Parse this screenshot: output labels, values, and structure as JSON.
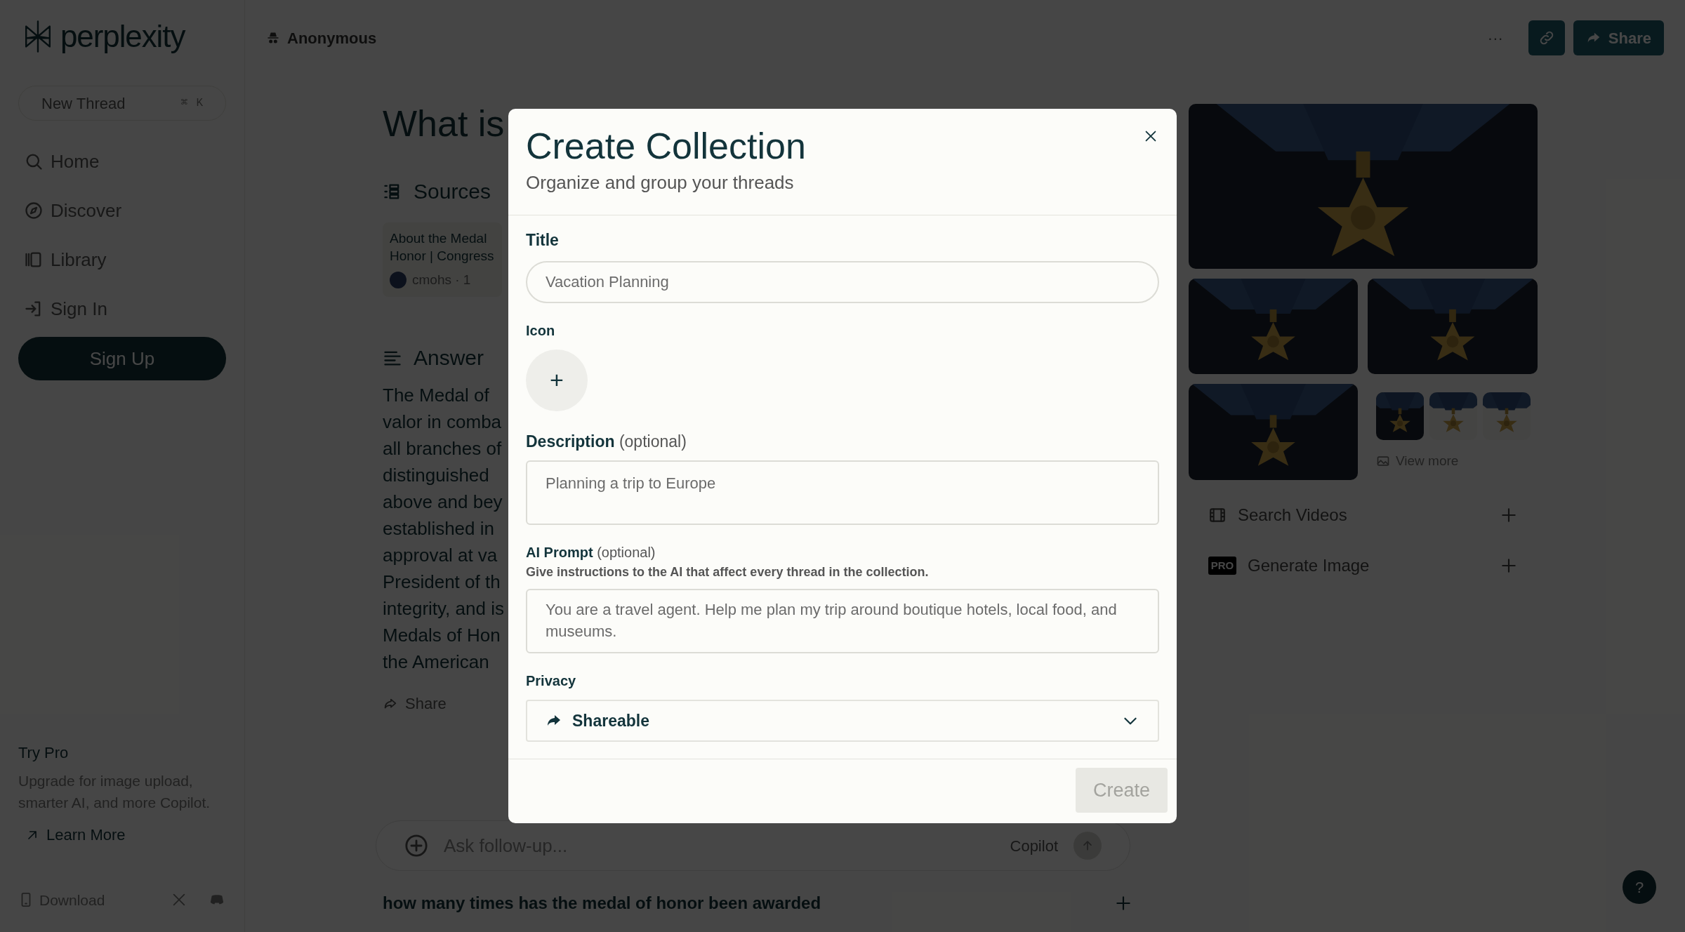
{
  "sidebar": {
    "logo": "perplexity",
    "new_thread": {
      "label": "New Thread",
      "keys": [
        "⌘",
        "K"
      ]
    },
    "items": [
      {
        "kind": "search",
        "label": "Home"
      },
      {
        "kind": "compass",
        "label": "Discover"
      },
      {
        "kind": "library",
        "label": "Library"
      },
      {
        "kind": "signin",
        "label": "Sign In"
      }
    ],
    "sign_up": "Sign Up",
    "promo": {
      "title": "Try Pro",
      "text": "Upgrade for image upload, smarter AI, and more Copilot.",
      "link": "Learn More"
    },
    "download": "Download"
  },
  "header": {
    "user": "Anonymous",
    "more": "···",
    "share": "Share"
  },
  "thread": {
    "question": "What is",
    "sources_heading": "Sources",
    "source": {
      "title": "About the Medal",
      "title_2": "Honor | Congress",
      "site": "cmohs · 1"
    },
    "answer_heading": "Answer",
    "answer_lines": [
      "The Medal of",
      "valor in comba",
      "all branches of",
      "distinguished",
      "above and bey",
      "established in",
      "approval at va",
      "President of th",
      "integrity, and is",
      "Medals of Hon",
      "the American"
    ],
    "share": "Share",
    "follow_up": {
      "placeholder": "Ask follow-up...",
      "mode": "Copilot"
    },
    "related": [
      "how many times has the medal of honor been awarded"
    ]
  },
  "media": {
    "view_more": "View more",
    "actions": [
      {
        "kind": "video",
        "label": "Search Videos"
      },
      {
        "kind": "pro",
        "label": "Generate Image",
        "badge": "PRO"
      }
    ]
  },
  "help": "?",
  "dialog": {
    "title": "Create Collection",
    "subtitle": "Organize and group your threads",
    "fields": [
      {
        "kind": "input",
        "label": "Title",
        "placeholder": "Vacation Planning"
      },
      {
        "kind": "icon",
        "label": "Icon",
        "button": "+"
      },
      {
        "kind": "textarea",
        "label": "Description",
        "optional": "(optional)",
        "placeholder": "Planning a trip to Europe"
      },
      {
        "kind": "prompt",
        "label": "AI Prompt",
        "optional": "(optional)",
        "hint": "Give instructions to the AI that affect every thread in the collection.",
        "placeholder": "You are a travel agent. Help me plan my trip around boutique hotels, local food, and museums."
      },
      {
        "kind": "select",
        "label": "Privacy",
        "value": "Shareable"
      }
    ],
    "create": {
      "label": "Create",
      "disabled": true
    }
  }
}
